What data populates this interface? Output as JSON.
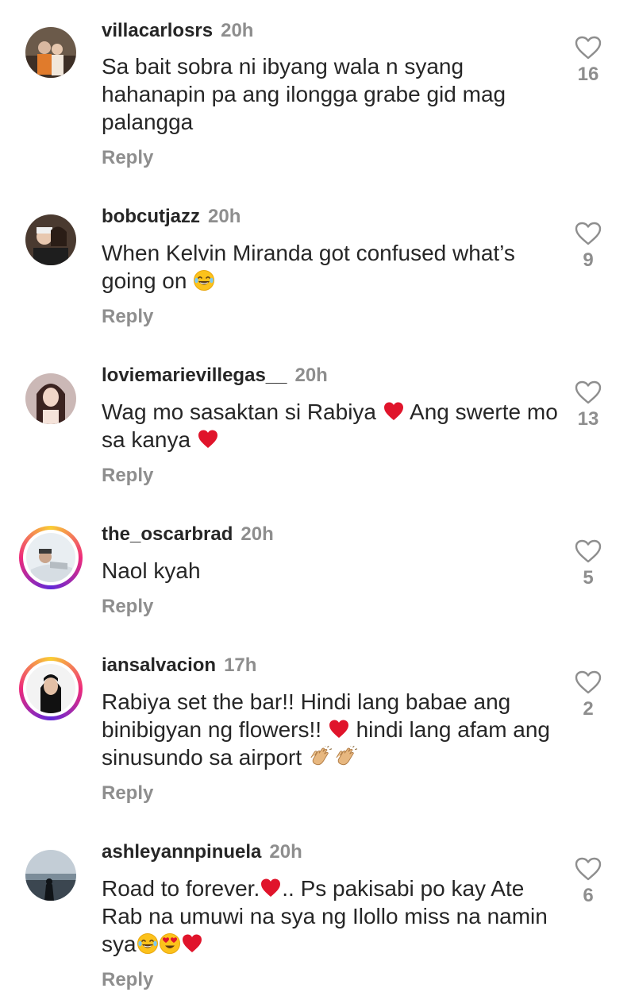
{
  "comments": [
    {
      "username": "villacarlosrs",
      "time": "20h",
      "text": "Sa bait sobra ni ibyang wala n syang hahanapin pa ang ilongga grabe gid mag palangga",
      "reply": "Reply",
      "likes": "16"
    },
    {
      "username": "bobcutjazz",
      "time": "20h",
      "text": "When Kelvin Miranda got confused what’s going on",
      "reply": "Reply",
      "likes": "9"
    },
    {
      "username": "loviemarievillegas__",
      "time": "20h",
      "text_a": "Wag mo sasaktan si Rabiya",
      "text_b": "Ang swerte mo sa kanya",
      "reply": "Reply",
      "likes": "13"
    },
    {
      "username": "the_oscarbrad",
      "time": "20h",
      "text": "Naol kyah",
      "reply": "Reply",
      "likes": "5"
    },
    {
      "username": "iansalvacion",
      "time": "17h",
      "text_a": "Rabiya set the bar!! Hindi lang babae ang binibigyan ng flowers!!",
      "text_b": "hindi lang afam ang sinusundo sa airport",
      "reply": "Reply",
      "likes": "2"
    },
    {
      "username": "ashleyannpinuela",
      "time": "20h",
      "text_a": "Road to forever.",
      "text_b": ".. Ps pakisabi po kay Ate Rab na umuwi na sya ng Ilollo miss na namin sya",
      "reply": "Reply",
      "likes": "6"
    }
  ],
  "icons": {
    "like": "heart-outline-icon",
    "laugh": "laughing-emoji-icon",
    "heart": "red-heart-emoji-icon",
    "clap": "clapping-hands-emoji-icon",
    "heart_eyes": "heart-eyes-emoji-icon"
  },
  "colors": {
    "text": "#262626",
    "muted": "#8e8e8e",
    "heart": "#e0245e"
  }
}
